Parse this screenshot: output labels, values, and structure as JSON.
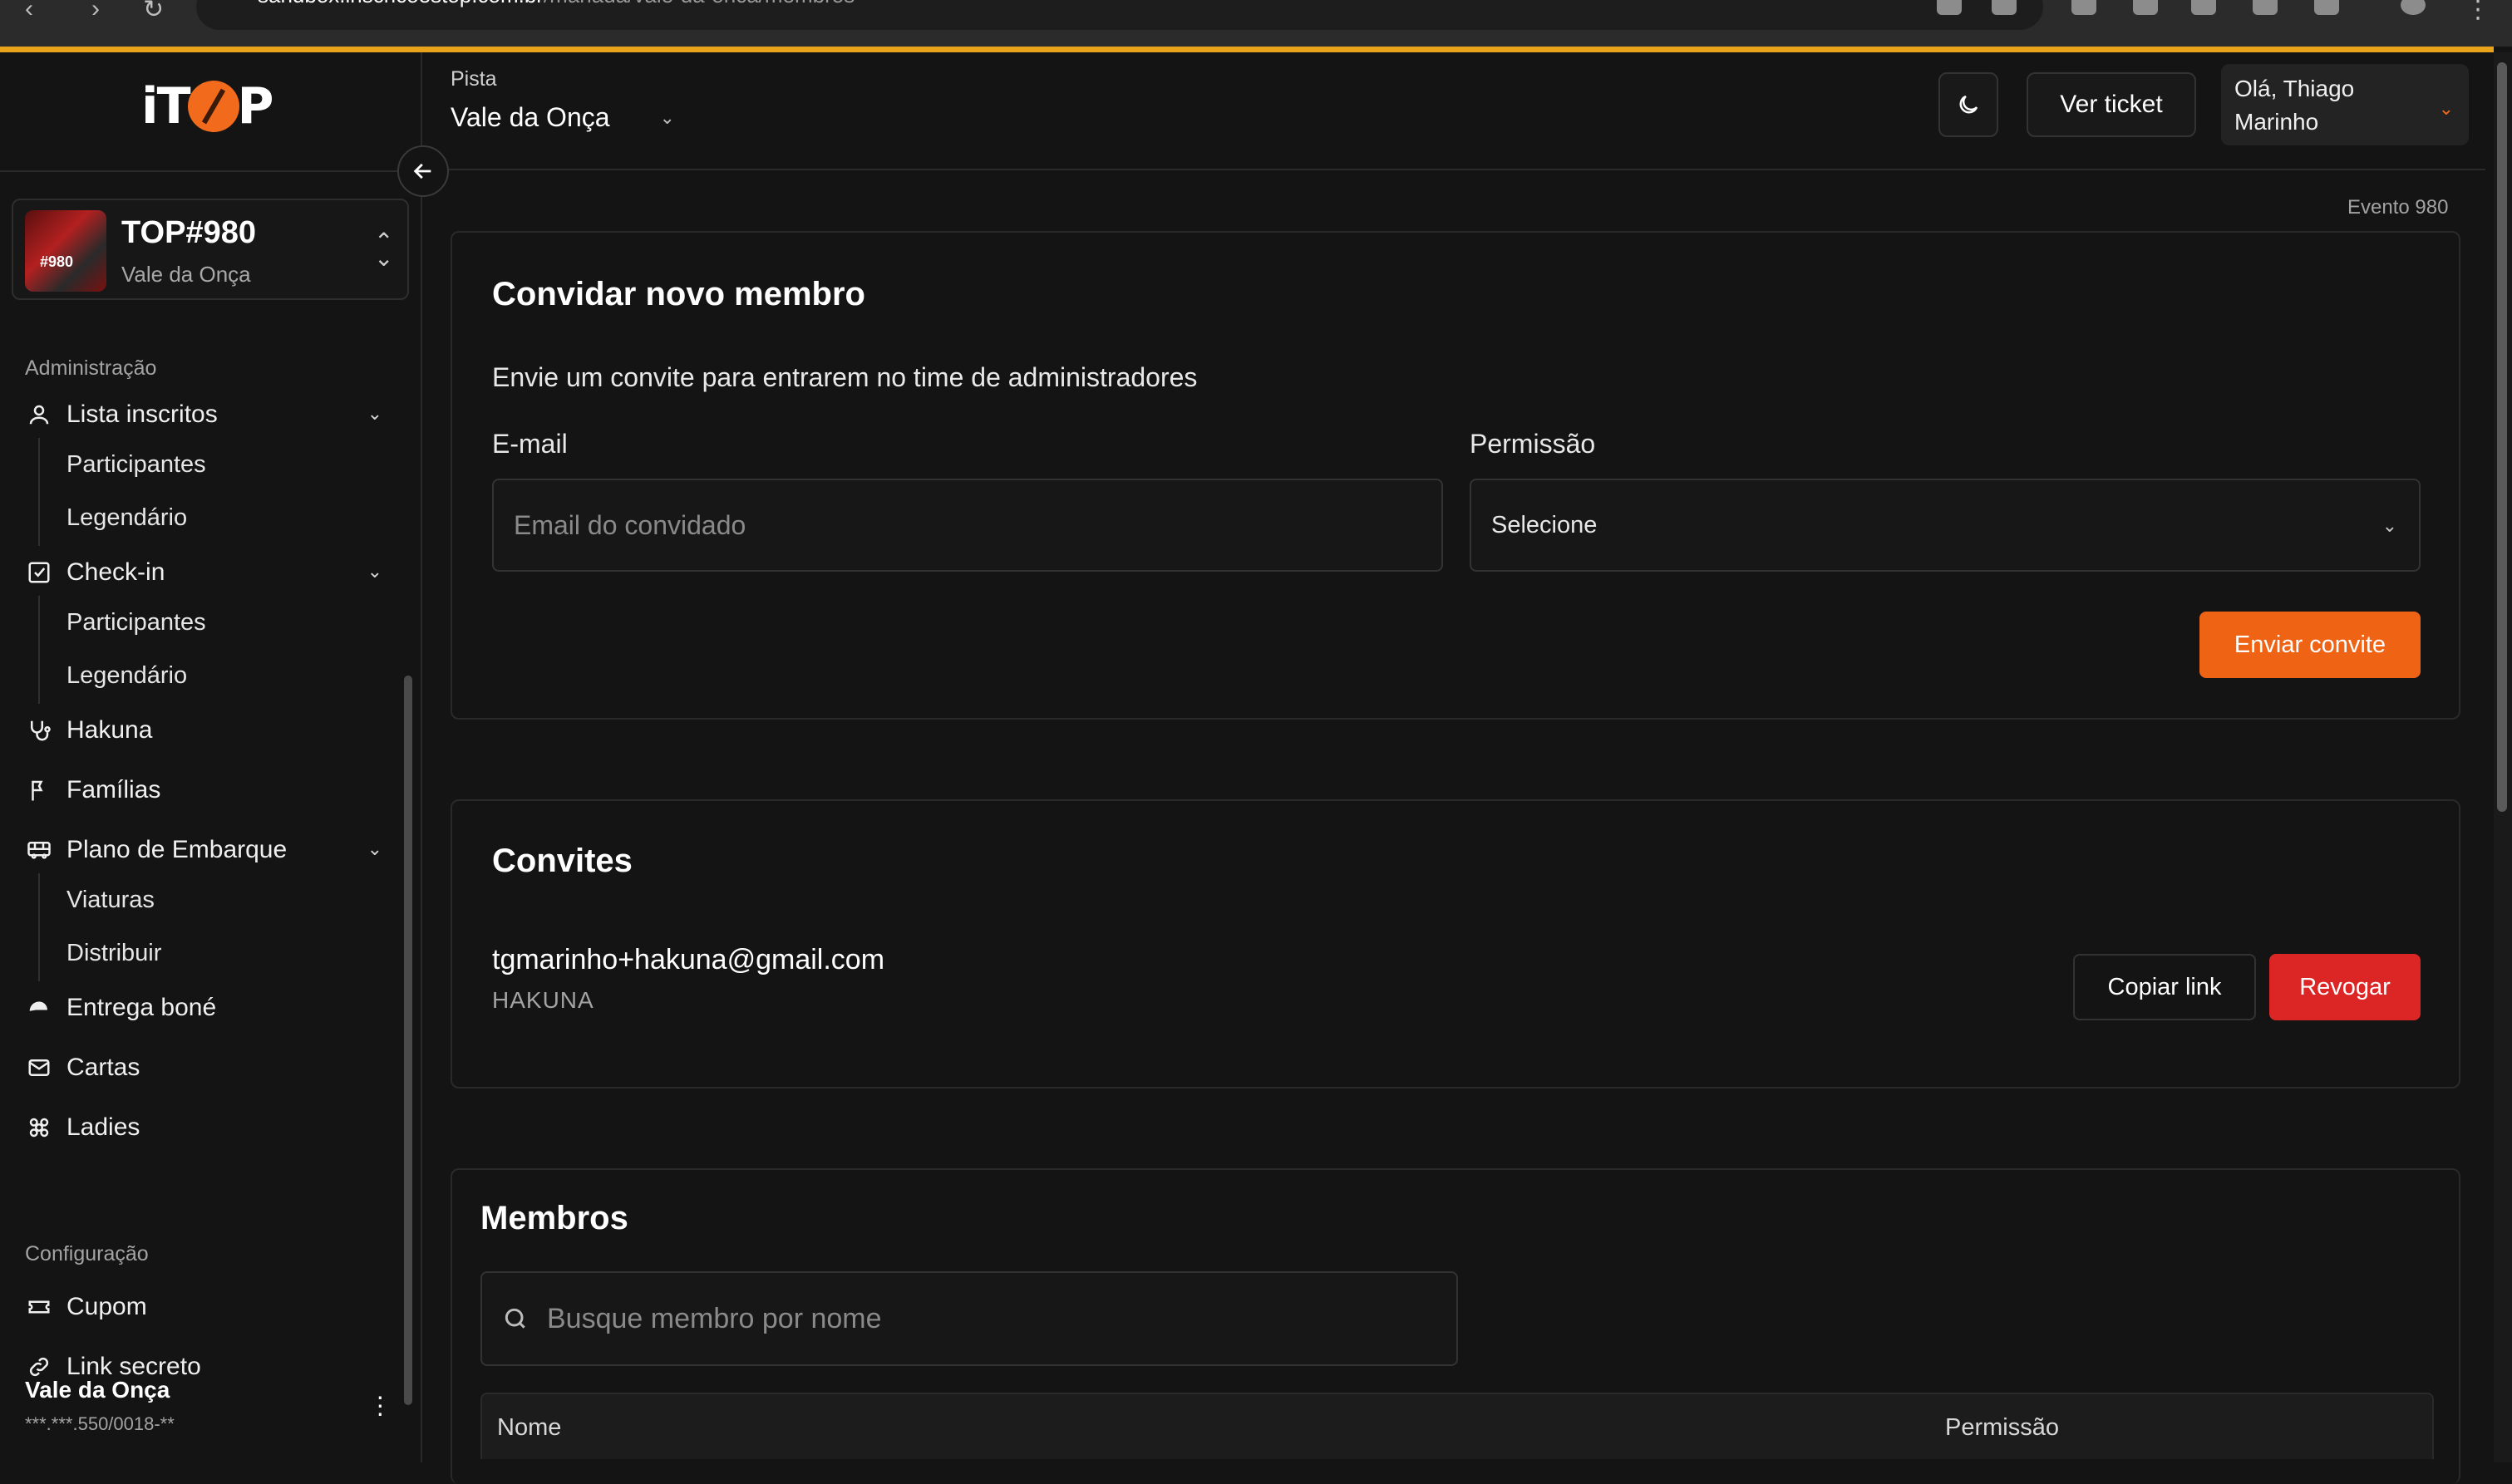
{
  "browser": {
    "url_host": "sandbox.inscricoestop.com.br",
    "url_path": "/manada/vale-da-onca/membros"
  },
  "brand": {
    "logo_text_left": "iT",
    "logo_text_right": "P"
  },
  "event_switcher": {
    "name": "TOP#980",
    "subtitle": "Vale da Onça",
    "thumb_text": "#980"
  },
  "sidebar": {
    "section_admin": "Administração",
    "lista_inscritos": {
      "label": "Lista inscritos",
      "items": [
        "Participantes",
        "Legendário"
      ]
    },
    "checkin": {
      "label": "Check-in",
      "items": [
        "Participantes",
        "Legendário"
      ]
    },
    "hakuna": "Hakuna",
    "familias": "Famílias",
    "plano_embarque": {
      "label": "Plano de Embarque",
      "items": [
        "Viaturas",
        "Distribuir"
      ]
    },
    "entrega_bone": "Entrega boné",
    "cartas": "Cartas",
    "ladies": "Ladies",
    "section_config": "Configuração",
    "cupom": "Cupom",
    "link_secreto": "Link secreto",
    "footer_name": "Vale da Onça",
    "footer_doc": "***.***.550/0018-**"
  },
  "header": {
    "pista_label": "Pista",
    "pista_value": "Vale da Onça",
    "ticket_button": "Ver ticket",
    "user_greeting_line1": "Olá, Thiago",
    "user_greeting_line2": "Marinho"
  },
  "main": {
    "evento_tag": "Evento 980",
    "invite_card": {
      "title": "Convidar novo membro",
      "description": "Envie um convite para entrarem no time de administradores",
      "email_label": "E-mail",
      "email_placeholder": "Email do convidado",
      "permission_label": "Permissão",
      "permission_value": "Selecione",
      "submit_label": "Enviar convite"
    },
    "invites_card": {
      "title": "Convites",
      "items": [
        {
          "email": "tgmarinho+hakuna@gmail.com",
          "role": "HAKUNA",
          "copy_label": "Copiar link",
          "revoke_label": "Revogar"
        }
      ]
    },
    "members_card": {
      "title": "Membros",
      "search_placeholder": "Busque membro por nome",
      "columns": [
        "Nome",
        "Permissão"
      ]
    }
  },
  "colors": {
    "accent": "#ef6414",
    "danger": "#dc2626",
    "top_line": "#e8a31a",
    "background": "#141414"
  }
}
